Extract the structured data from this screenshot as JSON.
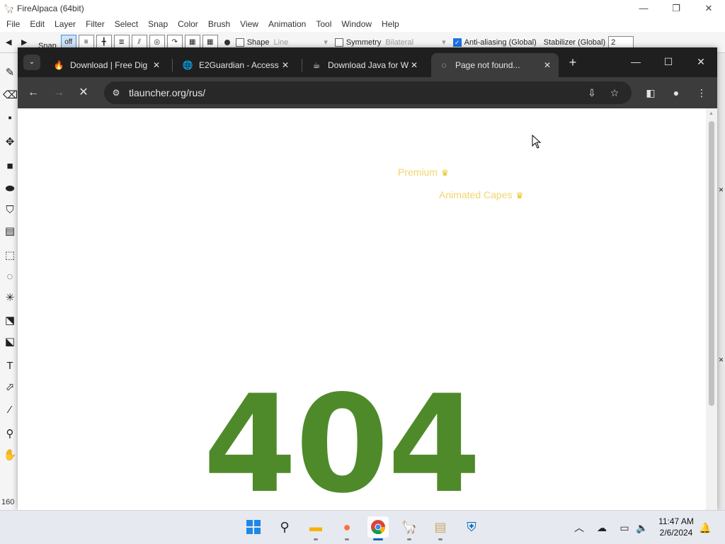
{
  "firealpaca": {
    "title": "FireAlpaca (64bit)",
    "menu": [
      "File",
      "Edit",
      "Layer",
      "Filter",
      "Select",
      "Snap",
      "Color",
      "Brush",
      "View",
      "Animation",
      "Tool",
      "Window",
      "Help"
    ],
    "toolbar": {
      "snap_label": "Snap",
      "snap_off_label": "off",
      "shape_label": "Shape",
      "shape_value": "Line",
      "symmetry_label": "Symmetry",
      "symmetry_value": "Bilateral",
      "antialiasing_label": "Anti-aliasing (Global)",
      "stabilizer_label": "Stabilizer (Global)",
      "stabilizer_value": "2"
    },
    "zoom": "160"
  },
  "browser": {
    "tabs": [
      {
        "title": "Download | Free Dig",
        "favicon": "fire-icon",
        "active": false
      },
      {
        "title": "E2Guardian - Access",
        "favicon": "globe-icon",
        "active": false
      },
      {
        "title": "Download Java for W",
        "favicon": "java-icon",
        "active": false
      },
      {
        "title": "Page not found...",
        "favicon": "loading-icon",
        "active": true
      }
    ],
    "url": "tlauncher.org/rus/",
    "page": {
      "premium": "Premium",
      "animated_capes": "Animated Capes",
      "error_code": "404"
    }
  },
  "taskbar": {
    "apps": [
      "start-icon",
      "search-icon",
      "file-explorer-icon",
      "firefox-icon",
      "chrome-icon",
      "firealpaca-icon",
      "notepad-icon",
      "windows-security-icon"
    ],
    "time": "11:47 AM",
    "date": "2/6/2024"
  },
  "colors": {
    "error_green": "#4f8a2a",
    "promo_gold": "#f2d56b",
    "chrome_dark": "#1f1f1f",
    "chrome_toolbar": "#3c3c3c"
  }
}
